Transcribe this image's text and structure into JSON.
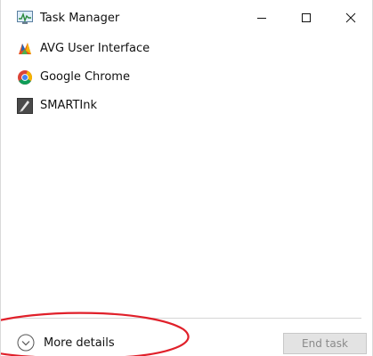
{
  "window": {
    "title": "Task Manager",
    "icon": "task-manager-icon",
    "controls": [
      "minimize-icon",
      "maximize-icon",
      "close-icon"
    ]
  },
  "processes": [
    {
      "label": "AVG User Interface",
      "icon": "avg-icon"
    },
    {
      "label": "Google Chrome",
      "icon": "chrome-icon"
    },
    {
      "label": "SMARTInk",
      "icon": "smartink-icon"
    }
  ],
  "footer": {
    "more_details_label": "More details",
    "more_details_icon": "chevron-down-circle-icon",
    "end_task_label": "End task",
    "end_task_enabled": false
  },
  "colors": {
    "annotation": "#e0202a",
    "disabled_button_bg": "#e3e3e3",
    "disabled_button_text": "#8a8a8a"
  }
}
